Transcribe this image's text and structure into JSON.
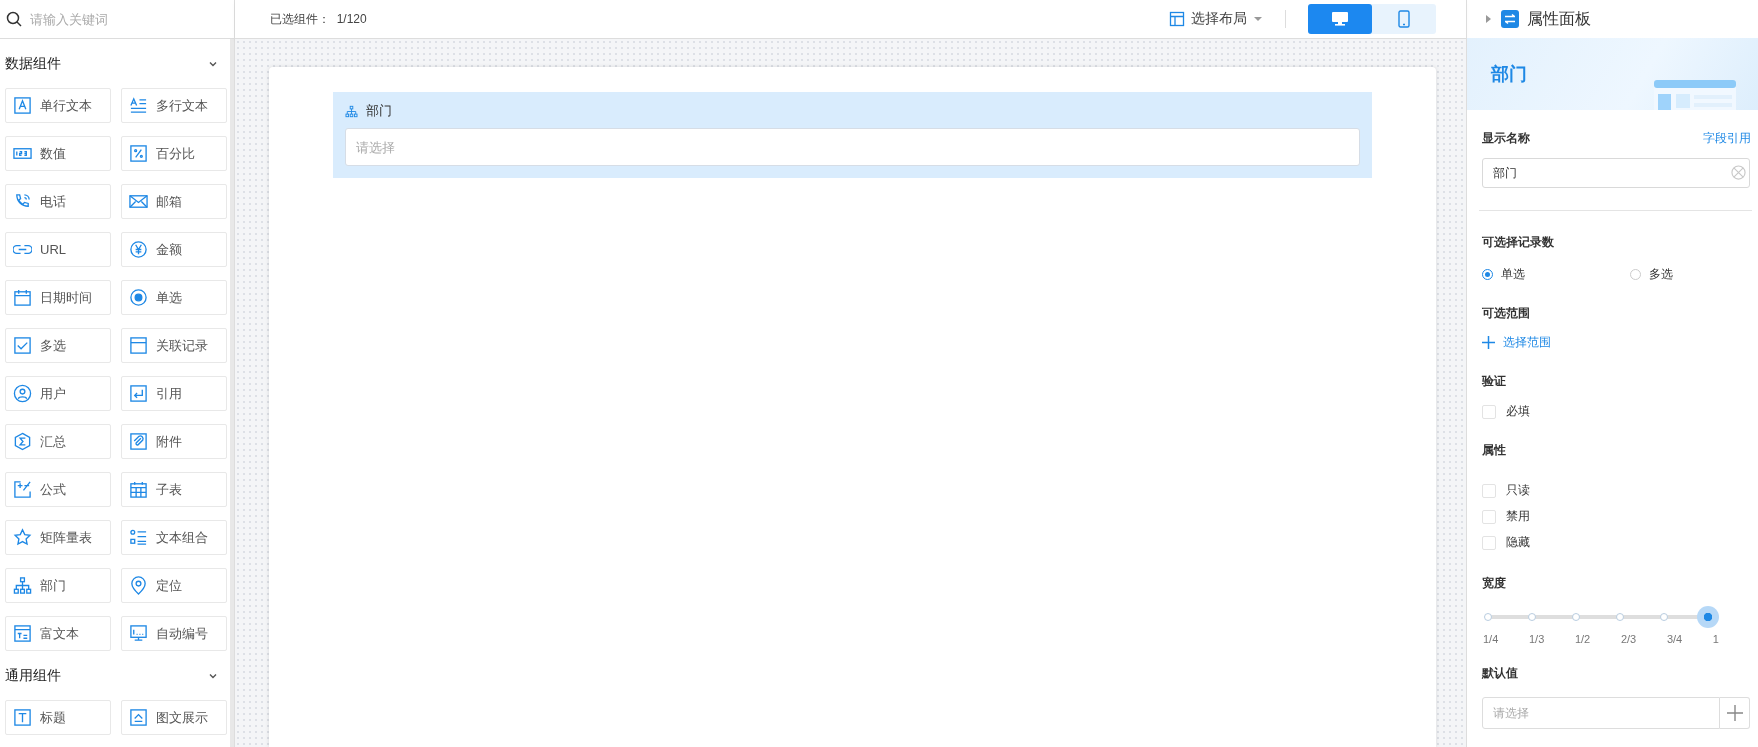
{
  "search": {
    "placeholder": "请输入关键词"
  },
  "groups": [
    {
      "title": "数据组件",
      "expanded": true,
      "items": [
        {
          "label": "单行文本",
          "kind": "text"
        },
        {
          "label": "多行文本",
          "kind": "textarea"
        },
        {
          "label": "数值",
          "kind": "number"
        },
        {
          "label": "百分比",
          "kind": "percent"
        },
        {
          "label": "电话",
          "kind": "phone"
        },
        {
          "label": "邮箱",
          "kind": "email"
        },
        {
          "label": "URL",
          "kind": "url"
        },
        {
          "label": "金额",
          "kind": "money"
        },
        {
          "label": "日期时间",
          "kind": "datetime"
        },
        {
          "label": "单选",
          "kind": "radio"
        },
        {
          "label": "多选",
          "kind": "checkbox"
        },
        {
          "label": "关联记录",
          "kind": "relation"
        },
        {
          "label": "用户",
          "kind": "user"
        },
        {
          "label": "引用",
          "kind": "reference"
        },
        {
          "label": "汇总",
          "kind": "summary"
        },
        {
          "label": "附件",
          "kind": "attachment"
        },
        {
          "label": "公式",
          "kind": "formula"
        },
        {
          "label": "子表",
          "kind": "subtable"
        },
        {
          "label": "矩阵量表",
          "kind": "matrix"
        },
        {
          "label": "文本组合",
          "kind": "textgroup"
        },
        {
          "label": "部门",
          "kind": "department"
        },
        {
          "label": "定位",
          "kind": "location"
        },
        {
          "label": "富文本",
          "kind": "richtext"
        },
        {
          "label": "自动编号",
          "kind": "autonumber"
        }
      ]
    },
    {
      "title": "通用组件",
      "expanded": true,
      "items": [
        {
          "label": "标题",
          "kind": "heading"
        },
        {
          "label": "图文展示",
          "kind": "imagetext"
        }
      ]
    }
  ],
  "toolbar": {
    "selected_count_label": "已选组件：",
    "selected_count": "1/120",
    "layout_button": "选择布局",
    "devices": [
      {
        "kind": "desktop",
        "selected": true
      },
      {
        "kind": "mobile",
        "selected": false
      }
    ]
  },
  "canvas": {
    "fields": [
      {
        "label": "部门",
        "kind": "department",
        "placeholder": "请选择"
      }
    ]
  },
  "properties": {
    "title": "属性面板",
    "banner_title": "部门",
    "display_name": {
      "label": "显示名称",
      "link": "字段引用",
      "value": "部门"
    },
    "record_count": {
      "label": "可选择记录数",
      "options": [
        {
          "label": "单选",
          "selected": true
        },
        {
          "label": "多选",
          "selected": false
        }
      ]
    },
    "range": {
      "label": "可选范围",
      "action": "选择范围"
    },
    "validation": {
      "label": "验证",
      "options": [
        {
          "label": "必填",
          "checked": false
        }
      ]
    },
    "attributes": {
      "label": "属性",
      "options": [
        {
          "label": "只读",
          "checked": false
        },
        {
          "label": "禁用",
          "checked": false
        },
        {
          "label": "隐藏",
          "checked": false
        }
      ]
    },
    "width": {
      "label": "宽度",
      "level": 1,
      "stops": [
        "1/4",
        "1/3",
        "1/2",
        "2/3",
        "3/4",
        "1"
      ]
    },
    "default_value": {
      "label": "默认值",
      "placeholder": "请选择"
    }
  }
}
